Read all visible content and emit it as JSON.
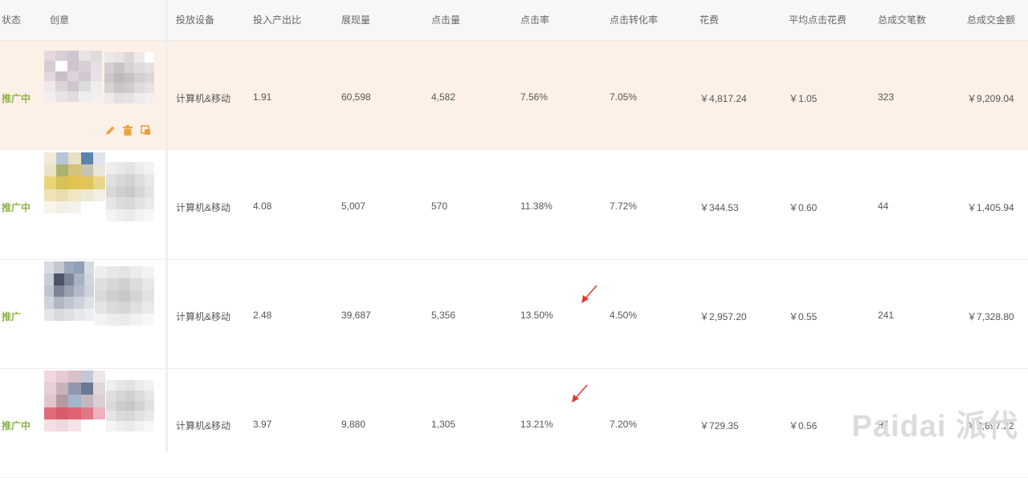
{
  "table": {
    "columns": [
      {
        "key": "status",
        "label": "状态"
      },
      {
        "key": "creative",
        "label": "创意"
      },
      {
        "key": "device",
        "label": "投放设备"
      },
      {
        "key": "roi",
        "label": "投入产出比"
      },
      {
        "key": "impressions",
        "label": "展现量"
      },
      {
        "key": "clicks",
        "label": "点击量"
      },
      {
        "key": "ctr",
        "label": "点击率"
      },
      {
        "key": "cvr",
        "label": "点击转化率"
      },
      {
        "key": "cost",
        "label": "花费"
      },
      {
        "key": "cpc",
        "label": "平均点击花费"
      },
      {
        "key": "orders",
        "label": "总成交笔数"
      },
      {
        "key": "gmv",
        "label": "总成交金额"
      }
    ],
    "rows": [
      {
        "status": "推广中",
        "device": "计算机&移动",
        "roi": "1.91",
        "impressions": "60,598",
        "clicks": "4,582",
        "ctr": "7.56%",
        "cvr": "7.05%",
        "cost": "￥4,817.24",
        "cpc": "￥1.05",
        "orders": "323",
        "gmv": "￥9,209.04"
      },
      {
        "status": "推广中",
        "device": "计算机&移动",
        "roi": "4.08",
        "impressions": "5,007",
        "clicks": "570",
        "ctr": "11.38%",
        "cvr": "7.72%",
        "cost": "￥344.53",
        "cpc": "￥0.60",
        "orders": "44",
        "gmv": "￥1,405.94"
      },
      {
        "status": "推广",
        "device": "计算机&移动",
        "roi": "2.48",
        "impressions": "39,687",
        "clicks": "5,356",
        "ctr": "13.50%",
        "cvr": "4.50%",
        "cost": "￥2,957.20",
        "cpc": "￥0.55",
        "orders": "241",
        "gmv": "￥7,328.80"
      },
      {
        "status": "推广中",
        "device": "计算机&移动",
        "roi": "3.97",
        "impressions": "9,880",
        "clicks": "1,305",
        "ctr": "13.21%",
        "cvr": "7.20%",
        "cost": "￥729.35",
        "cpc": "￥0.56",
        "orders": "94",
        "gmv": "￥2,897.22"
      }
    ],
    "row_actions": [
      "edit-icon",
      "delete-icon",
      "copy-icon"
    ]
  },
  "watermark": {
    "text": "Paidai 派代"
  },
  "colors": {
    "accent": "#f0a040",
    "status_green": "#8cb34a",
    "annotation_red": "#e03a2f",
    "active_row_bg": "#fdf1e7"
  }
}
